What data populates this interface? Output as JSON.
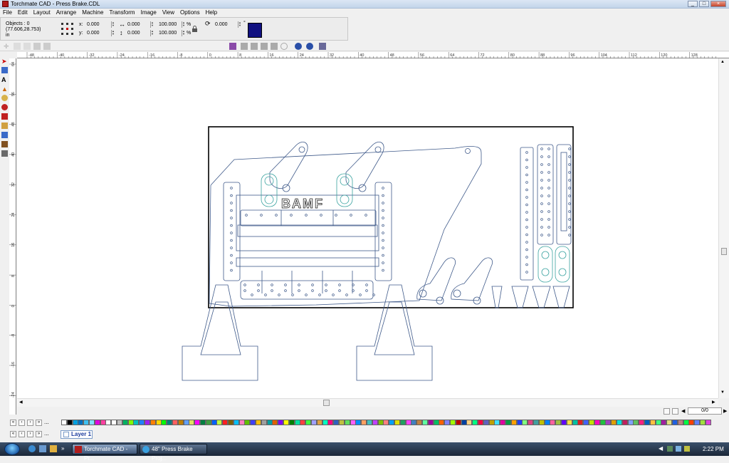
{
  "window": {
    "title": "Torchmate CAD - Press Brake.CDL",
    "min": "_",
    "max": "□",
    "close": "×"
  },
  "menu": [
    "File",
    "Edit",
    "Layout",
    "Arrange",
    "Machine",
    "Transform",
    "Image",
    "View",
    "Options",
    "Help"
  ],
  "properties": {
    "objects_label": "Objects : 0",
    "coords": "(77.606,28.753)",
    "units": "in",
    "x_label": "x:",
    "x_value": "0.000",
    "y_label": "y:",
    "y_value": "0.000",
    "width_value": "0.000",
    "height_value": "0.000",
    "scale_w": "100.000",
    "scale_h": "100.000",
    "pct": "%",
    "rotation": "0.000",
    "deg": "°"
  },
  "ruler_h_ticks": [
    "-48",
    "-40",
    "-32",
    "-24",
    "-16",
    "-8",
    "0",
    "8",
    "16",
    "24",
    "32",
    "40",
    "48",
    "56",
    "64",
    "72",
    "80",
    "88",
    "96",
    "104",
    "112",
    "120",
    "128"
  ],
  "ruler_v_ticks": [
    "64",
    "56",
    "48",
    "40",
    "32",
    "24",
    "16",
    "8",
    "0",
    "-8",
    "-16",
    "-24"
  ],
  "drawing": {
    "logo_text": "BAMF",
    "outline_color": "#3f5a8a",
    "accent_color": "#3aa3a0",
    "frame_color": "#000000"
  },
  "palette_colors": [
    "#ffffff",
    "#000000",
    "#00a0e0",
    "#0070c0",
    "#40c0f0",
    "#80e0ff",
    "#e000e0",
    "#ff40a0",
    "#ffffff",
    "#ffffff",
    "#c0c0c0",
    "#00b060",
    "#80ff00",
    "#00c0c0",
    "#2080ff",
    "#a020f0",
    "#ff8000",
    "#ffd800",
    "#00ff00",
    "#008080",
    "#ff6060",
    "#c08000",
    "#60a0ff",
    "#e0e060",
    "#ff00ff",
    "#008040",
    "#40a040",
    "#0060ff",
    "#c0ff40",
    "#ff2020",
    "#806000",
    "#00c0ff",
    "#ff80c0",
    "#60c000",
    "#4040ff",
    "#ffc000",
    "#a0a0a0",
    "#00a0a0",
    "#e06000",
    "#8000ff",
    "#ffff00",
    "#008000",
    "#00e0a0",
    "#ff4040",
    "#40ff40",
    "#a0a0ff",
    "#e0a040",
    "#00ffc0",
    "#ff0080",
    "#3060c0",
    "#c0c040",
    "#60e060",
    "#ff60ff",
    "#0090ff",
    "#ffa060",
    "#40c0c0",
    "#c040ff",
    "#80c000",
    "#ff8080",
    "#00a0ff",
    "#e0e000",
    "#20a060",
    "#ff40ff",
    "#4080c0",
    "#c08040",
    "#60ffa0",
    "#a000a0",
    "#00c060",
    "#ff6000",
    "#8080ff",
    "#a0ff00",
    "#c00000",
    "#0040a0",
    "#ffd080",
    "#00ff80",
    "#ff0040",
    "#6060c0",
    "#c0a000",
    "#40e0ff",
    "#e000a0",
    "#00a040",
    "#ffa000",
    "#2040ff",
    "#80ff80",
    "#e04080",
    "#40a0a0",
    "#c0c000",
    "#0080ff",
    "#ff60a0",
    "#a0c040",
    "#6000ff",
    "#ffe040",
    "#00c0a0",
    "#e02020",
    "#4060ff",
    "#c0e000",
    "#ff00c0",
    "#20c040",
    "#a040c0",
    "#e0a000",
    "#00e0e0",
    "#c02060",
    "#80a0ff",
    "#60c060",
    "#ff2080",
    "#0060c0",
    "#ffc040",
    "#40ff80",
    "#a020a0",
    "#e0e080",
    "#2060e0",
    "#c08080",
    "#00ff40",
    "#ff4000",
    "#6080ff",
    "#a0e040",
    "#e040e0"
  ],
  "page_nav": {
    "page": "0/0"
  },
  "layer": {
    "name": "Layer 1"
  },
  "taskbar": {
    "items": [
      {
        "label": "Torchmate CAD - Pr..."
      },
      {
        "label": "48\" Press Brake Proj..."
      }
    ],
    "time": "2:22 PM"
  }
}
